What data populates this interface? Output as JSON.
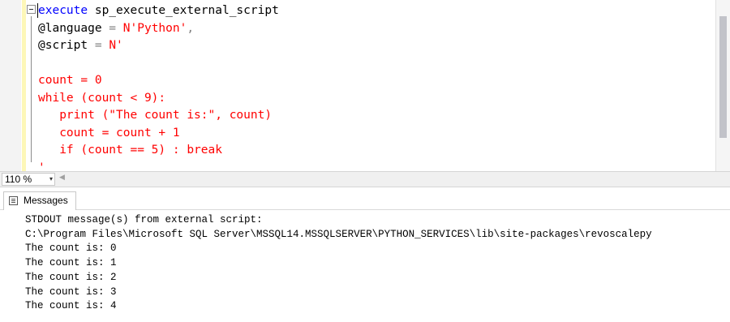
{
  "editor": {
    "lines": [
      [
        {
          "t": "execute",
          "c": "kw"
        },
        {
          "t": " sp_execute_external_script",
          "c": "plain"
        }
      ],
      [
        {
          "t": "@language",
          "c": "var"
        },
        {
          "t": " = ",
          "c": "op"
        },
        {
          "t": "N'Python'",
          "c": "str"
        },
        {
          "t": ",",
          "c": "op"
        }
      ],
      [
        {
          "t": "@script",
          "c": "var"
        },
        {
          "t": " = ",
          "c": "op"
        },
        {
          "t": "N'",
          "c": "str"
        }
      ],
      [
        {
          "t": "",
          "c": "str"
        }
      ],
      [
        {
          "t": "count = 0",
          "c": "str"
        }
      ],
      [
        {
          "t": "while (count < 9):",
          "c": "str"
        }
      ],
      [
        {
          "t": "   print (\"The count is:\", count)",
          "c": "str"
        }
      ],
      [
        {
          "t": "   count = count + 1",
          "c": "str"
        }
      ],
      [
        {
          "t": "   if (count == 5) : break",
          "c": "str"
        }
      ],
      [
        {
          "t": "'",
          "c": "str"
        }
      ]
    ]
  },
  "zoom": {
    "value": "110 %",
    "arrow": "▾",
    "scroll_left": "◀"
  },
  "results": {
    "tab_label": "Messages",
    "output": [
      "STDOUT message(s) from external script:",
      "C:\\Program Files\\Microsoft SQL Server\\MSSQL14.MSSQLSERVER\\PYTHON_SERVICES\\lib\\site-packages\\revoscalepy",
      "The count is: 0",
      "The count is: 1",
      "The count is: 2",
      "The count is: 3",
      "The count is: 4"
    ]
  },
  "colors": {
    "keyword": "#0000ff",
    "string": "#ff0000",
    "operator": "#808080"
  }
}
